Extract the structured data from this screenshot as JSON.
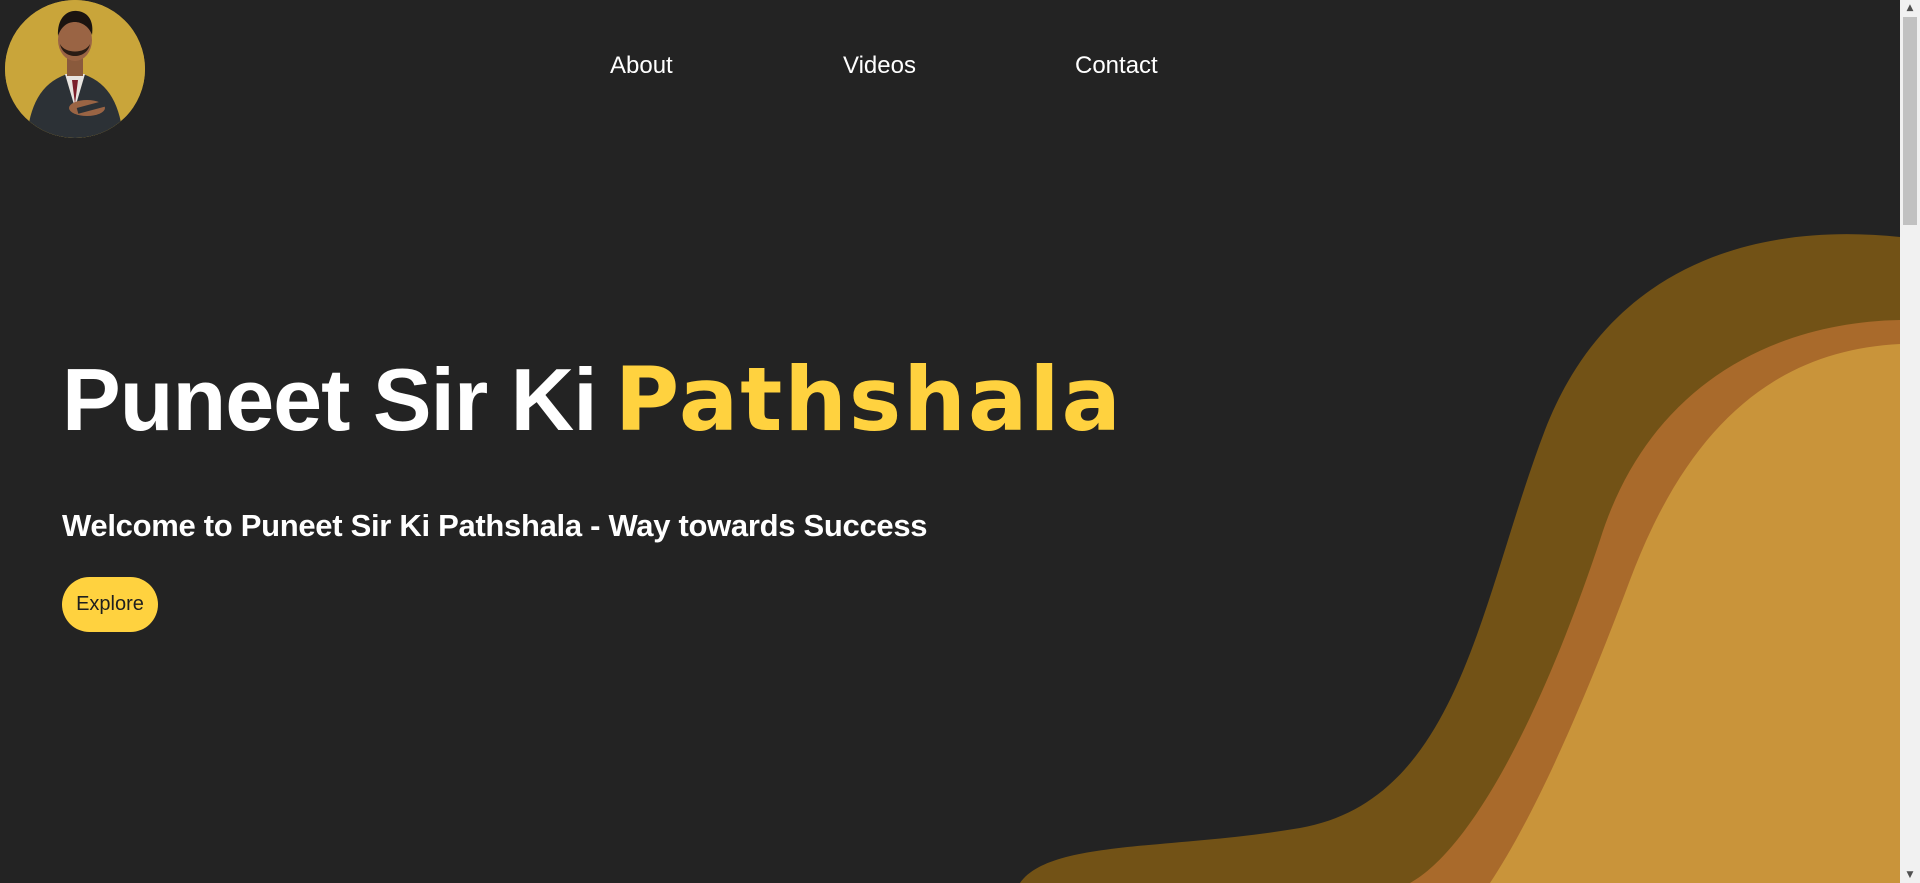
{
  "nav": {
    "items": [
      {
        "label": "About"
      },
      {
        "label": "Videos"
      },
      {
        "label": "Contact"
      }
    ]
  },
  "hero": {
    "title_main": "Puneet Sir Ki",
    "title_accent": "Pathshala",
    "subtitle": "Welcome to Puneet Sir Ki Pathshala - Way towards Success",
    "button_label": "Explore"
  },
  "colors": {
    "background": "#232323",
    "accent": "#ffd23f",
    "wave_dark": "#725216",
    "wave_mid": "#a96a2b",
    "wave_light": "#c9943a"
  },
  "icons": {
    "avatar": "profile-photo",
    "scroll_up": "scroll-up-arrow-icon",
    "scroll_down": "scroll-down-arrow-icon"
  },
  "scrollbar": {
    "thumb_fraction": 0.24
  }
}
